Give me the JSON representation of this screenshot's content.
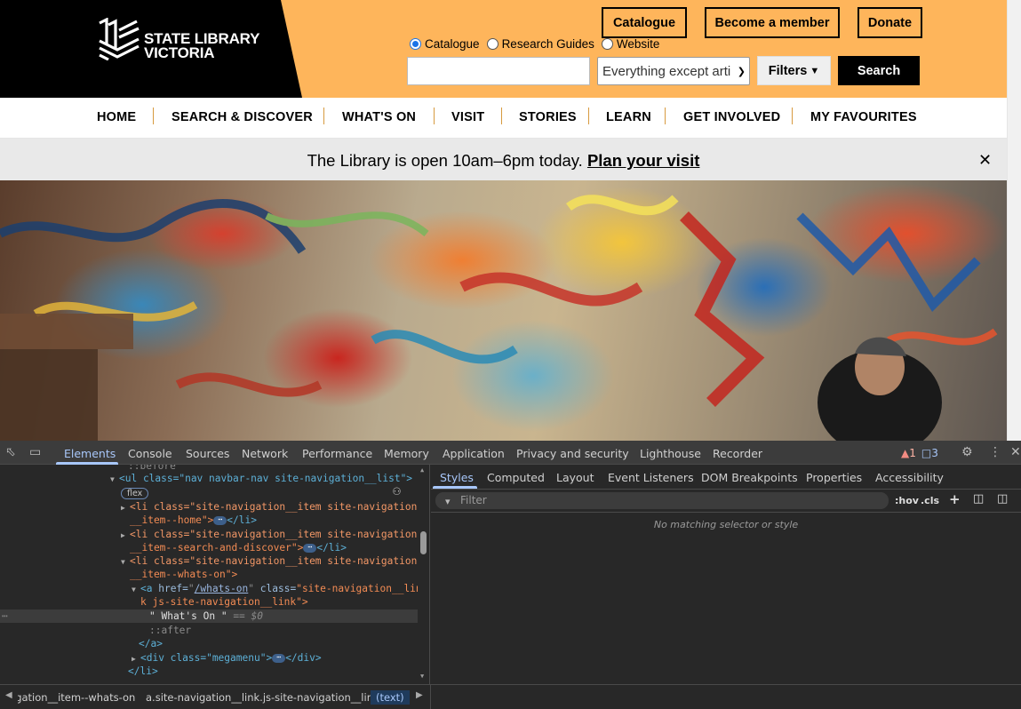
{
  "site": {
    "logo": {
      "line1": "STATE LIBRARY",
      "line2": "VICTORIA"
    },
    "header_buttons": {
      "catalogue": "Catalogue",
      "member": "Become a member",
      "donate": "Donate"
    },
    "search": {
      "scopes": [
        {
          "label": "Catalogue",
          "selected": true
        },
        {
          "label": "Research Guides",
          "selected": false
        },
        {
          "label": "Website",
          "selected": false
        }
      ],
      "input_value": "",
      "select_value": "Everything except arti",
      "filters_label": "Filters",
      "submit_label": "Search"
    },
    "nav": [
      "HOME",
      "SEARCH & DISCOVER",
      "WHAT'S ON",
      "VISIT",
      "STORIES",
      "LEARN",
      "GET INVOLVED",
      "MY FAVOURITES"
    ],
    "notice": {
      "text": "The Library is open 10am–6pm today.",
      "link": "Plan your visit"
    },
    "colors": {
      "accent": "#feb55b",
      "nav_separator": "#d79a3f",
      "notice_bg": "#e9e9e9"
    }
  },
  "devtools": {
    "tabs": [
      "Elements",
      "Console",
      "Sources",
      "Network",
      "Performance",
      "Memory",
      "Application",
      "Privacy and security",
      "Lighthouse",
      "Recorder"
    ],
    "active_tab": "Elements",
    "warnings": "1",
    "messages": "3",
    "dom": {
      "before": "::before",
      "ul_open": "<ul class=\"nav navbar-nav site-navigation__list\">",
      "flex_badge": "flex",
      "li_home_1": "<li class=\"site-navigation__item site-navigation",
      "li_home_2": "__item--home\">",
      "li_search_1": "<li class=\"site-navigation__item site-navigation",
      "li_search_2": "__item--search-and-discover\">",
      "li_whats_1": "<li class=\"site-navigation__item site-navigation",
      "li_whats_2": "__item--whats-on\">",
      "a_1_href": "/whats-on",
      "a_1_class": "site-navigation__lin",
      "a_2": "k js-site-navigation__link\">",
      "text_node": "\" What's On \"",
      "text_eq": "== $0",
      "after": "::after",
      "a_close": "</a>",
      "div_megamenu": "<div class=\"megamenu\">",
      "div_close": "</div>",
      "li_close": "</li>",
      "li_close_tag": "</li>"
    },
    "styles_tabs": [
      "Styles",
      "Computed",
      "Layout",
      "Event Listeners",
      "DOM Breakpoints",
      "Properties",
      "Accessibility"
    ],
    "active_styles_tab": "Styles",
    "filter_placeholder": "Filter",
    "hov_label": ":hov",
    "cls_label": ".cls",
    "no_match": "No matching selector or style",
    "breadcrumbs": [
      "li.site-navigation__item.site-navigation__item--whats-on",
      "a.site-navigation__link.js-site-navigation__link",
      "(text)"
    ],
    "breadcrumb_visible_first": "igation__item--whats-on"
  }
}
